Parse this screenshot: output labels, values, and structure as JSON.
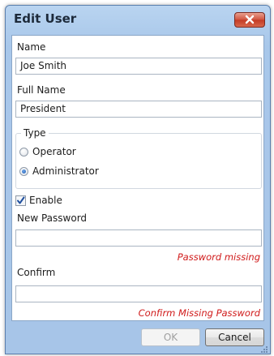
{
  "window": {
    "title": "Edit User"
  },
  "form": {
    "name_label": "Name",
    "name_value": "Joe Smith",
    "full_name_label": "Full Name",
    "full_name_value": "President",
    "type_group": {
      "legend": "Type",
      "options": [
        {
          "label": "Operator",
          "selected": false
        },
        {
          "label": "Administrator",
          "selected": true
        }
      ]
    },
    "enable": {
      "label": "Enable",
      "checked": true
    },
    "new_password_label": "New Password",
    "new_password_value": "",
    "new_password_error": "Password missing",
    "confirm_label": "Confirm",
    "confirm_value": "",
    "confirm_error": "Confirm Missing Password"
  },
  "buttons": {
    "ok_label": "OK",
    "ok_enabled": false,
    "cancel_label": "Cancel"
  },
  "icons": {
    "close": "close-icon",
    "checkmark": "checkmark-icon",
    "resize_grip": "resize-grip-icon"
  },
  "colors": {
    "titlebar": "#b9d4f0",
    "close_button": "#c33a24",
    "error_text": "#d01a1a",
    "radio_selected": "#1f5db3"
  }
}
